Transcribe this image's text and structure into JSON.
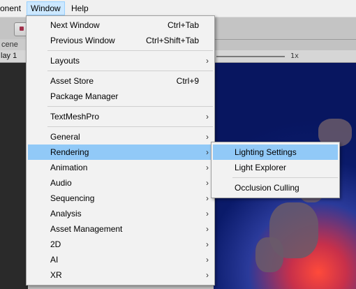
{
  "menubar": {
    "items": [
      {
        "label": "onent"
      },
      {
        "label": "Window"
      },
      {
        "label": "Help"
      }
    ]
  },
  "editor": {
    "scene_tab": "cene",
    "display_label": "lay 1",
    "scale_label": "1x"
  },
  "window_menu": {
    "items": [
      {
        "label": "Next Window",
        "shortcut": "Ctrl+Tab"
      },
      {
        "label": "Previous Window",
        "shortcut": "Ctrl+Shift+Tab"
      },
      {
        "label": "Layouts",
        "submenu": true
      },
      {
        "label": "Asset Store",
        "shortcut": "Ctrl+9"
      },
      {
        "label": "Package Manager"
      },
      {
        "label": "TextMeshPro",
        "submenu": true
      },
      {
        "label": "General",
        "submenu": true
      },
      {
        "label": "Rendering",
        "submenu": true,
        "highlighted": true
      },
      {
        "label": "Animation",
        "submenu": true
      },
      {
        "label": "Audio",
        "submenu": true
      },
      {
        "label": "Sequencing",
        "submenu": true
      },
      {
        "label": "Analysis",
        "submenu": true
      },
      {
        "label": "Asset Management",
        "submenu": true
      },
      {
        "label": "2D",
        "submenu": true
      },
      {
        "label": "AI",
        "submenu": true
      },
      {
        "label": "XR",
        "submenu": true
      }
    ],
    "arrow_glyph": "›"
  },
  "rendering_submenu": {
    "items": [
      {
        "label": "Lighting Settings",
        "highlighted": true
      },
      {
        "label": "Light Explorer"
      },
      {
        "label": "Occlusion Culling"
      }
    ]
  },
  "colors": {
    "highlight": "#91c9f7",
    "menu_bg": "#f2f2f2",
    "active_menubar": "#cce8ff"
  }
}
